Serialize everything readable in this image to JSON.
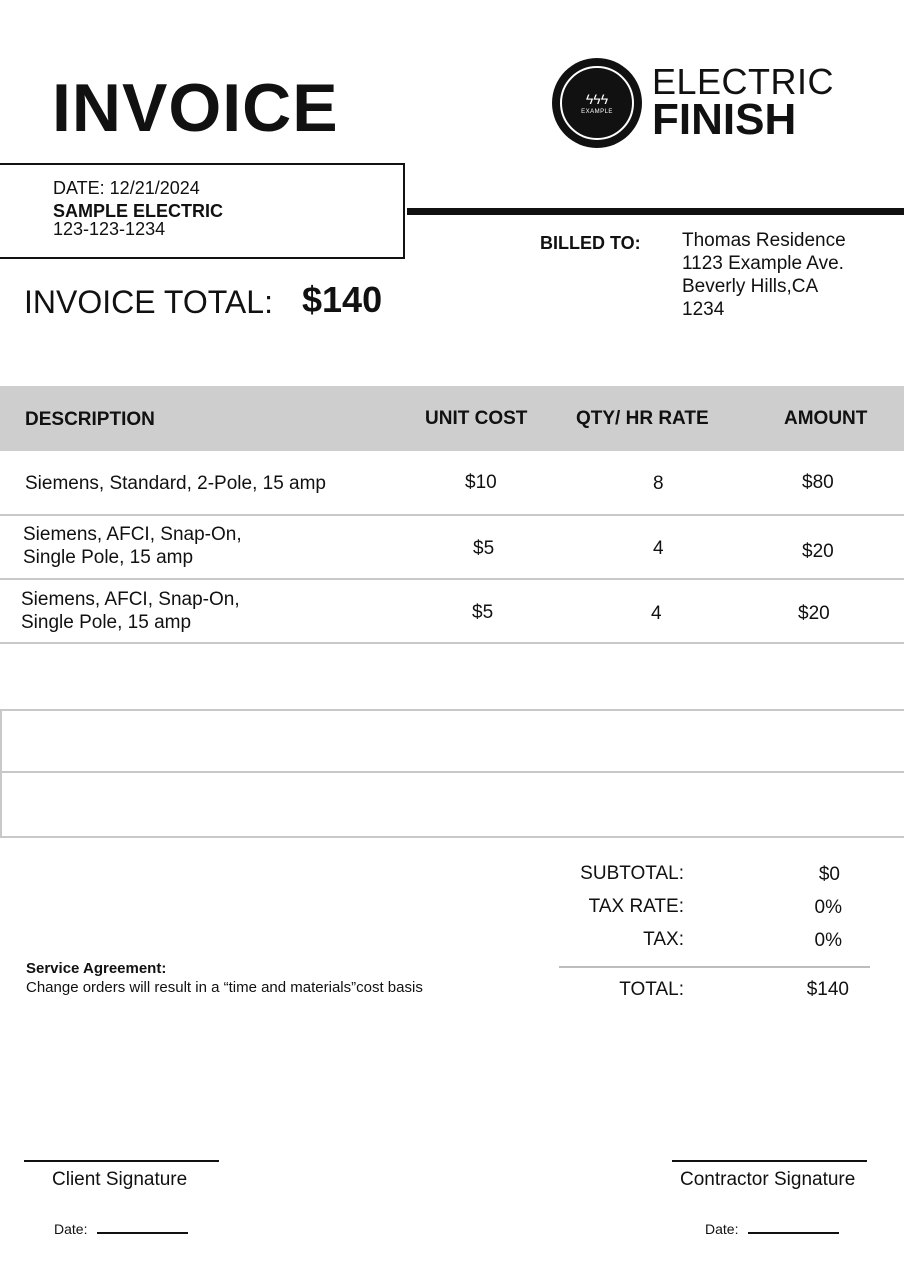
{
  "document": {
    "title": "INVOICE"
  },
  "brand": {
    "logo_text": "EXAMPLE",
    "line1": "ELECTRIC",
    "line2": "FINISH",
    "icon": "lightning-bolts-icon"
  },
  "issuer": {
    "date": "DATE: 12/21/2024",
    "company": "SAMPLE ELECTRIC",
    "phone": "123-123-1234"
  },
  "billed_to": {
    "label": "BILLED TO:",
    "lines": [
      "Thomas Residence",
      "1123 Example Ave.",
      "Beverly Hills,CA",
      "1234"
    ]
  },
  "invoice_total": {
    "label": "INVOICE TOTAL:",
    "value": "$140"
  },
  "table": {
    "headers": [
      "DESCRIPTION",
      "UNIT COST",
      "QTY/ HR RATE",
      "AMOUNT"
    ],
    "rows": [
      {
        "description_line1": "Siemens, Standard, 2-Pole, 15 amp",
        "description_line2": "",
        "unit_cost": "$10",
        "qty": "8",
        "amount": "$80"
      },
      {
        "description_line1": "Siemens, AFCI, Snap-On,",
        "description_line2": "Single Pole, 15 amp",
        "unit_cost": "$5",
        "qty": "4",
        "amount": "$20"
      },
      {
        "description_line1": "Siemens, AFCI, Snap-On,",
        "description_line2": "Single Pole, 15 amp",
        "unit_cost": "$5",
        "qty": "4",
        "amount": "$20"
      }
    ]
  },
  "summary": {
    "subtotal_label": "SUBTOTAL:",
    "subtotal_value": "$0",
    "tax_rate_label": "TAX RATE:",
    "tax_rate_value": "0%",
    "tax_label": "TAX:",
    "tax_value": "0%",
    "total_label": "TOTAL:",
    "total_value": "$140"
  },
  "agreement": {
    "title": "Service Agreement:",
    "text": "Change orders will result in a “time and materials”cost basis"
  },
  "signatures": {
    "client_label": "Client Signature",
    "contractor_label": "Contractor Signature",
    "date_label": "Date:"
  }
}
